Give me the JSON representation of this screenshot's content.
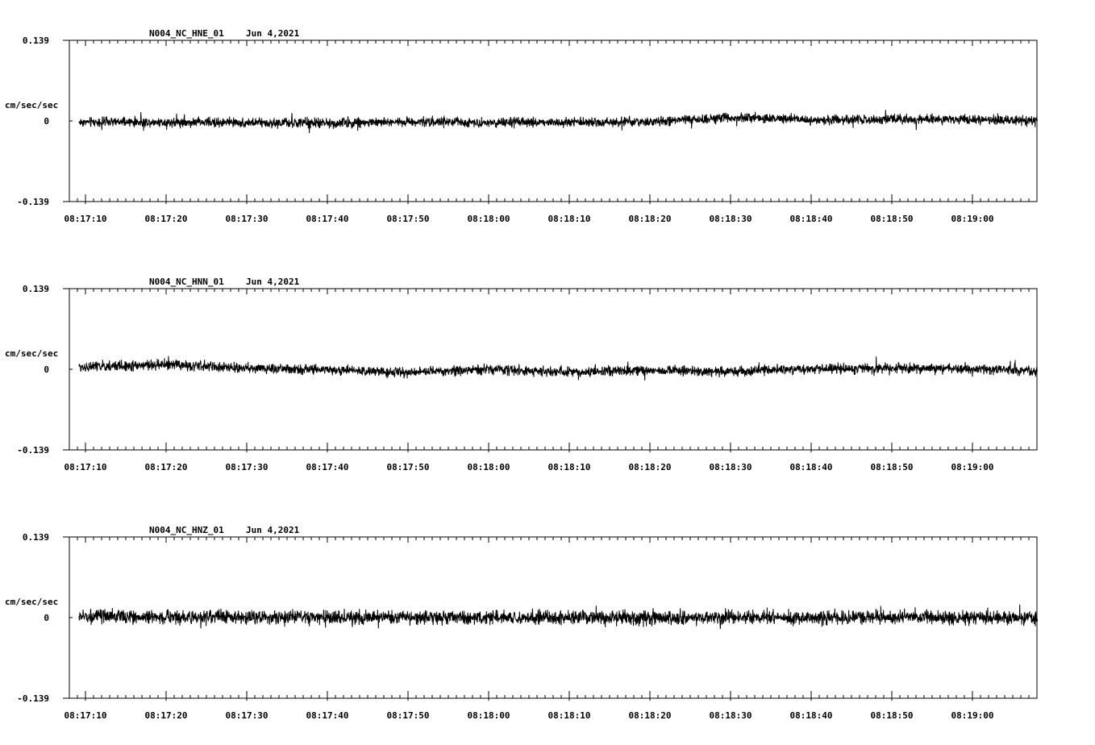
{
  "chart_data": [
    {
      "type": "line",
      "title": "N004_NC_HNE_01",
      "date": "Jun 4,2021",
      "ylabel": "cm/sec/sec",
      "ylim": [
        -0.139,
        0.139
      ],
      "ytick_labels": [
        "0.139",
        "0",
        "-0.139"
      ],
      "xlim": [
        "08:17:09",
        "08:19:08"
      ],
      "xtick_labels": [
        "08:17:10",
        "08:17:20",
        "08:17:30",
        "08:17:40",
        "08:17:50",
        "08:18:00",
        "08:18:10",
        "08:18:20",
        "08:18:30",
        "08:18:40",
        "08:18:50",
        "08:19:00"
      ],
      "series": [
        {
          "x": [
            "08:17:10",
            "08:17:20",
            "08:17:30",
            "08:17:40",
            "08:17:50",
            "08:18:00",
            "08:18:10",
            "08:18:20",
            "08:18:30",
            "08:18:40",
            "08:18:50",
            "08:19:00",
            "08:19:08"
          ],
          "y": [
            -0.002,
            -0.002,
            -0.003,
            -0.004,
            -0.001,
            -0.003,
            -0.002,
            -0.002,
            0.006,
            0.002,
            0.003,
            0.002,
            0.001
          ],
          "amplitude": [
            0.012,
            0.012,
            0.012,
            0.013,
            0.012,
            0.012,
            0.012,
            0.012,
            0.013,
            0.012,
            0.012,
            0.013,
            0.012
          ]
        }
      ]
    },
    {
      "type": "line",
      "title": "N004_NC_HNN_01",
      "date": "Jun 4,2021",
      "ylabel": "cm/sec/sec",
      "ylim": [
        -0.139,
        0.139
      ],
      "ytick_labels": [
        "0.139",
        "0",
        "-0.139"
      ],
      "xlim": [
        "08:17:09",
        "08:19:08"
      ],
      "xtick_labels": [
        "08:17:10",
        "08:17:20",
        "08:17:30",
        "08:17:40",
        "08:17:50",
        "08:18:00",
        "08:18:10",
        "08:18:20",
        "08:18:30",
        "08:18:40",
        "08:18:50",
        "08:19:00"
      ],
      "series": [
        {
          "x": [
            "08:17:10",
            "08:17:20",
            "08:17:30",
            "08:17:40",
            "08:17:50",
            "08:18:00",
            "08:18:10",
            "08:18:20",
            "08:18:30",
            "08:18:40",
            "08:18:50",
            "08:19:00",
            "08:19:08"
          ],
          "y": [
            0.004,
            0.008,
            0.002,
            -0.001,
            -0.005,
            0.0,
            -0.005,
            -0.002,
            -0.004,
            0.001,
            0.002,
            0.0,
            -0.002
          ],
          "amplitude": [
            0.013,
            0.014,
            0.012,
            0.012,
            0.012,
            0.012,
            0.013,
            0.012,
            0.013,
            0.012,
            0.013,
            0.012,
            0.012
          ]
        }
      ]
    },
    {
      "type": "line",
      "title": "N004_NC_HNZ_01",
      "date": "Jun 4,2021",
      "ylabel": "cm/sec/sec",
      "ylim": [
        -0.139,
        0.139
      ],
      "ytick_labels": [
        "0.139",
        "0",
        "-0.139"
      ],
      "xlim": [
        "08:17:09",
        "08:19:08"
      ],
      "xtick_labels": [
        "08:17:10",
        "08:17:20",
        "08:17:30",
        "08:17:40",
        "08:17:50",
        "08:18:00",
        "08:18:10",
        "08:18:20",
        "08:18:30",
        "08:18:40",
        "08:18:50",
        "08:19:00"
      ],
      "series": [
        {
          "x": [
            "08:17:10",
            "08:17:20",
            "08:17:30",
            "08:17:40",
            "08:17:50",
            "08:18:00",
            "08:18:10",
            "08:18:20",
            "08:18:30",
            "08:18:40",
            "08:18:50",
            "08:19:00",
            "08:19:08"
          ],
          "y": [
            0.002,
            0.001,
            0.001,
            0.0,
            0.0,
            0.0,
            0.0,
            0.0,
            0.0,
            0.0,
            0.001,
            0.0,
            0.0
          ],
          "amplitude": [
            0.017,
            0.018,
            0.017,
            0.018,
            0.017,
            0.018,
            0.017,
            0.018,
            0.017,
            0.018,
            0.017,
            0.018,
            0.017
          ]
        }
      ]
    }
  ]
}
